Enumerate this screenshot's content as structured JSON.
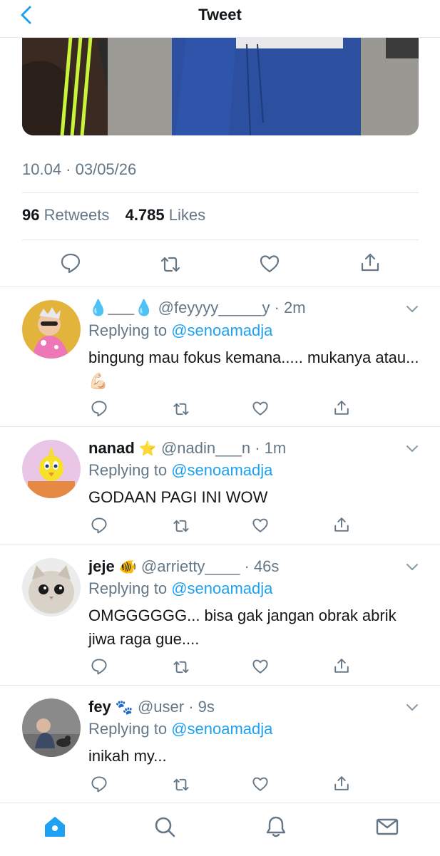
{
  "header": {
    "title": "Tweet",
    "back_icon": "chevron-left-icon"
  },
  "tweet": {
    "timestamp": "10.04 · 03/05/26",
    "retweets_count": "96",
    "retweets_label": "Retweets",
    "likes_count": "4.785",
    "likes_label": "Likes",
    "actions": [
      "reply-icon",
      "retweet-icon",
      "like-icon",
      "share-icon"
    ]
  },
  "replies": [
    {
      "name": "💧___💧",
      "handle": "@feyyyy_____y",
      "time": "· 2m",
      "replying_label": "Replying to",
      "mention": "@senoamadja",
      "text": "bingung mau fokus kemana..... mukanya atau... 💪🏻"
    },
    {
      "name": "nanad",
      "badge_emoji": "⭐",
      "handle": "@nadin___n",
      "time": "· 1m",
      "replying_label": "Replying to",
      "mention": "@senoamadja",
      "text": "GODAAN PAGI INI WOW"
    },
    {
      "name": "jeje",
      "badge_emoji": "🐠",
      "handle": "@arrietty____",
      "time": "· 46s",
      "replying_label": "Replying to",
      "mention": "@senoamadja",
      "text": "OMGGGGGG... bisa gak jangan obrak abrik jiwa raga gue...."
    },
    {
      "name": "fey",
      "badge_emoji": "🐾",
      "handle": "@user",
      "time": "· 9s",
      "replying_label": "Replying to",
      "mention": "@senoamadja",
      "text": "inikah my..."
    }
  ],
  "tabbar": {
    "items": [
      "home-icon",
      "search-icon",
      "notifications-icon",
      "messages-icon"
    ],
    "active_color": "#1da1f2"
  },
  "colors": {
    "accent": "#1da1f2",
    "secondary_text": "#657786",
    "divider": "#e1e8ed"
  }
}
